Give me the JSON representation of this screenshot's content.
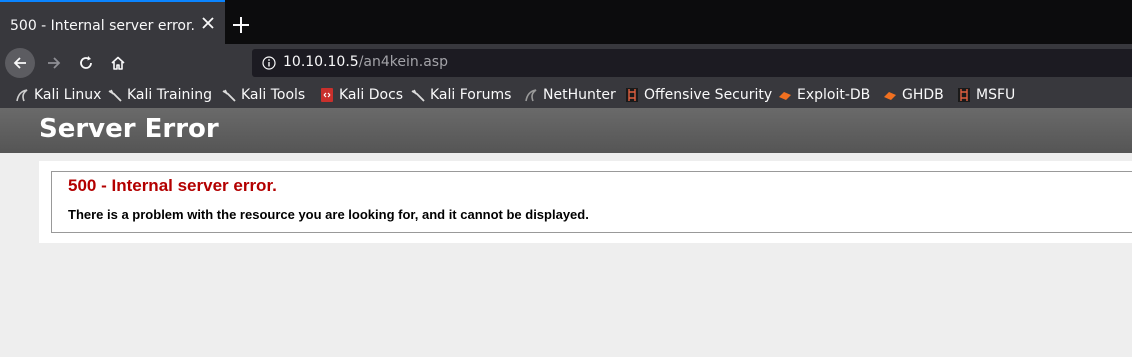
{
  "browser": {
    "tab": {
      "title": "500 - Internal server error."
    },
    "url": {
      "host": "10.10.10.5",
      "path": "/an4kein.asp"
    },
    "bookmarks": [
      {
        "label": "Kali Linux",
        "icon": "kali-dragon-icon"
      },
      {
        "label": "Kali Training",
        "icon": "kali-dragon-icon"
      },
      {
        "label": "Kali Tools",
        "icon": "kali-dragon-icon"
      },
      {
        "label": "Kali Docs",
        "icon": "kali-docs-icon"
      },
      {
        "label": "Kali Forums",
        "icon": "kali-dragon-icon"
      },
      {
        "label": "NetHunter",
        "icon": "nethunter-icon"
      },
      {
        "label": "Offensive Security",
        "icon": "offsec-icon"
      },
      {
        "label": "Exploit-DB",
        "icon": "exploit-db-icon"
      },
      {
        "label": "GHDB",
        "icon": "ghdb-icon"
      },
      {
        "label": "MSFU",
        "icon": "msfu-icon"
      }
    ]
  },
  "page": {
    "header": "Server Error",
    "error_title": "500 - Internal server error.",
    "error_description": "There is a problem with the resource you are looking for, and it cannot be displayed."
  },
  "colors": {
    "accent": "#0a84ff",
    "error_title": "#b30000",
    "header_bg": "#5f5f5f"
  }
}
